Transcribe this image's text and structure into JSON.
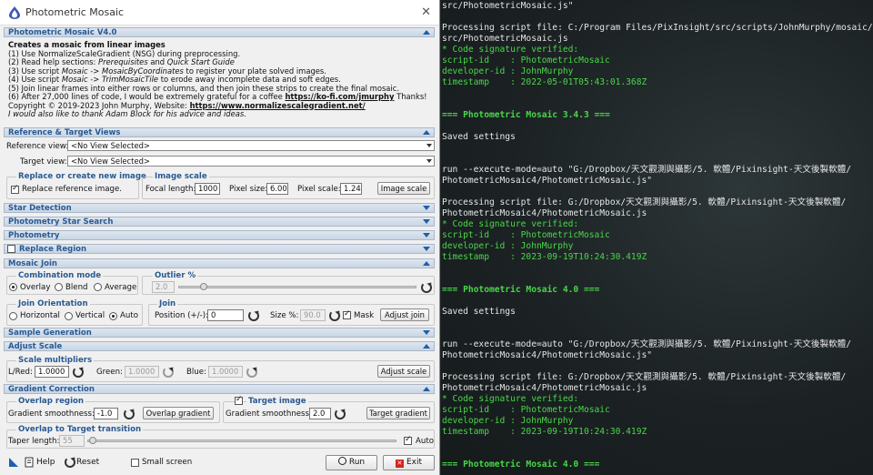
{
  "dialog": {
    "title": "Photometric Mosaic"
  },
  "main_section": {
    "label": "Photometric Mosaic V4.0"
  },
  "intro": {
    "heading": "Creates a mosaic from linear images",
    "l1": "(1) Use NormalizeScaleGradient (NSG) during preprocessing.",
    "l2a": "(2) Read help sections: ",
    "l2b": "Prerequisites",
    "l2c": " and ",
    "l2d": "Quick Start Guide",
    "l3a": "(3) Use script ",
    "l3b": "Mosaic -> MosaicByCoordinates",
    "l3c": " to register your plate solved images.",
    "l4a": "(4) Use script ",
    "l4b": "Mosaic -> TrimMosaicTile",
    "l4c": " to erode away incomplete data and soft edges.",
    "l5": "(5) Join linear frames into either rows or columns, and then join these strips to create the final mosaic.",
    "l6a": "(6) After 27,000 lines of code, I would be extremely grateful for a coffee ",
    "l6b": "https://ko-fi.com/jmurphy",
    "l6c": " Thanks!",
    "l7a": "Copyright © 2019-2023 John Murphy, Website: ",
    "l7b": "https://www.normalizescalegradient.net/",
    "l8": "I would also like to thank Adam Block for his advice and ideas."
  },
  "ref_target": {
    "label": "Reference & Target Views",
    "reference_label": "Reference view:",
    "reference_value": "<No View Selected>",
    "target_label": "Target view:",
    "target_value": "<No View Selected>"
  },
  "replace_group": {
    "title": "Replace or create new image",
    "check_label": "Replace reference image."
  },
  "image_scale": {
    "title": "Image scale",
    "focal_label": "Focal length:",
    "focal_value": "1000",
    "pixel_size_label": "Pixel size:",
    "pixel_size_value": "6.00",
    "pixel_scale_label": "Pixel scale:",
    "pixel_scale_value": "1.24",
    "button": "Image scale"
  },
  "sections": {
    "star_detection": "Star Detection",
    "photometry_star_search": "Photometry Star Search",
    "photometry": "Photometry",
    "replace_region": "Replace Region",
    "mosaic_join": "Mosaic Join",
    "sample_generation": "Sample Generation",
    "adjust_scale": "Adjust Scale",
    "gradient_correction": "Gradient Correction"
  },
  "combination": {
    "title": "Combination mode",
    "options": [
      "Overlay",
      "Blend",
      "Average"
    ],
    "selected": "Overlay"
  },
  "outlier": {
    "title": "Outlier %",
    "value": "2.0"
  },
  "join_orientation": {
    "title": "Join Orientation",
    "options": [
      "Horizontal",
      "Vertical",
      "Auto"
    ],
    "selected": "Auto"
  },
  "join": {
    "title": "Join",
    "position_label": "Position (+/-):",
    "position_value": "0",
    "size_label": "Size %:",
    "size_value": "90.0",
    "mask_label": "Mask",
    "button": "Adjust join"
  },
  "scale_multipliers": {
    "title": "Scale multipliers",
    "red_label": "L/Red:",
    "red_value": "1.0000",
    "green_label": "Green:",
    "green_value": "1.0000",
    "blue_label": "Blue:",
    "blue_value": "1.0000",
    "button": "Adjust scale"
  },
  "overlap_region": {
    "title": "Overlap region",
    "smooth_label": "Gradient smoothness:",
    "smooth_value": "-1.0",
    "button": "Overlap gradient"
  },
  "target_image": {
    "title": "Target image",
    "smooth_label": "Gradient smoothness:",
    "smooth_value": "2.0",
    "button": "Target gradient"
  },
  "transition": {
    "title": "Overlap to Target transition",
    "taper_label": "Taper length:",
    "taper_value": "55",
    "auto_label": "Auto"
  },
  "bottom": {
    "help": "Help",
    "reset": "Reset",
    "small_screen": "Small screen",
    "run": "Run",
    "exit": "Exit"
  },
  "console": {
    "lines": [
      {
        "t": "src/PhotometricMosaic.js\"",
        "c": "w"
      },
      {
        "t": "",
        "c": "w"
      },
      {
        "t": "Processing script file: C:/Program Files/PixInsight/src/scripts/JohnMurphy/mosaic/",
        "c": "w"
      },
      {
        "t": "src/PhotometricMosaic.js",
        "c": "w"
      },
      {
        "t": "* Code signature verified:",
        "c": "g"
      },
      {
        "t": "script-id    : PhotometricMosaic",
        "c": "g"
      },
      {
        "t": "developer-id : JohnMurphy",
        "c": "g"
      },
      {
        "t": "timestamp    : 2022-05-01T05:43:01.368Z",
        "c": "g"
      },
      {
        "t": "",
        "c": "w"
      },
      {
        "t": "",
        "c": "w"
      },
      {
        "t": "=== Photometric Mosaic 3.4.3 ===",
        "c": "hdr"
      },
      {
        "t": "",
        "c": "w"
      },
      {
        "t": "Saved settings",
        "c": "w"
      },
      {
        "t": "",
        "c": "w"
      },
      {
        "t": "",
        "c": "w"
      },
      {
        "t": "run --execute-mode=auto \"G:/Dropbox/天文觀測與攝影/5. 軟體/Pixinsight-天文後製軟體/",
        "c": "w"
      },
      {
        "t": "PhotometricMosaic4/PhotometricMosaic.js\"",
        "c": "w"
      },
      {
        "t": "",
        "c": "w"
      },
      {
        "t": "Processing script file: G:/Dropbox/天文觀測與攝影/5. 軟體/Pixinsight-天文後製軟體/",
        "c": "w"
      },
      {
        "t": "PhotometricMosaic4/PhotometricMosaic.js",
        "c": "w"
      },
      {
        "t": "* Code signature verified:",
        "c": "g"
      },
      {
        "t": "script-id    : PhotometricMosaic",
        "c": "g"
      },
      {
        "t": "developer-id : JohnMurphy",
        "c": "g"
      },
      {
        "t": "timestamp    : 2023-09-19T10:24:30.419Z",
        "c": "g"
      },
      {
        "t": "",
        "c": "w"
      },
      {
        "t": "",
        "c": "w"
      },
      {
        "t": "=== Photometric Mosaic 4.0 ===",
        "c": "hdr"
      },
      {
        "t": "",
        "c": "w"
      },
      {
        "t": "Saved settings",
        "c": "w"
      },
      {
        "t": "",
        "c": "w"
      },
      {
        "t": "",
        "c": "w"
      },
      {
        "t": "run --execute-mode=auto \"G:/Dropbox/天文觀測與攝影/5. 軟體/Pixinsight-天文後製軟體/",
        "c": "w"
      },
      {
        "t": "PhotometricMosaic4/PhotometricMosaic.js\"",
        "c": "w"
      },
      {
        "t": "",
        "c": "w"
      },
      {
        "t": "Processing script file: G:/Dropbox/天文觀測與攝影/5. 軟體/Pixinsight-天文後製軟體/",
        "c": "w"
      },
      {
        "t": "PhotometricMosaic4/PhotometricMosaic.js",
        "c": "w"
      },
      {
        "t": "* Code signature verified:",
        "c": "g"
      },
      {
        "t": "script-id    : PhotometricMosaic",
        "c": "g"
      },
      {
        "t": "developer-id : JohnMurphy",
        "c": "g"
      },
      {
        "t": "timestamp    : 2023-09-19T10:24:30.419Z",
        "c": "g"
      },
      {
        "t": "",
        "c": "w"
      },
      {
        "t": "",
        "c": "w"
      },
      {
        "t": "=== Photometric Mosaic 4.0 ===",
        "c": "hdr"
      }
    ]
  }
}
